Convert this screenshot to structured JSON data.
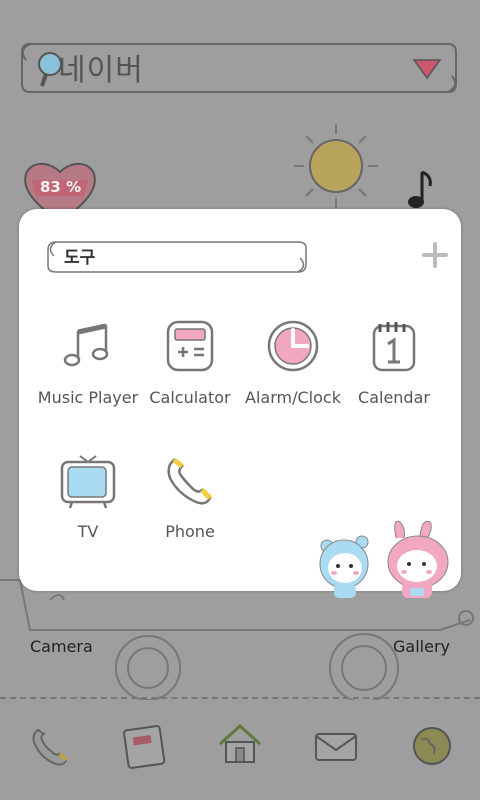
{
  "search": {
    "text": "네이버"
  },
  "battery": {
    "percent_text": "83 %"
  },
  "home": {
    "camera_label": "Camera",
    "gallery_label": "Gallery"
  },
  "folder": {
    "name": "도구",
    "apps": [
      {
        "label": "Music Player",
        "icon": "music-note-icon"
      },
      {
        "label": "Calculator",
        "icon": "calculator-icon"
      },
      {
        "label": "Alarm/Clock",
        "icon": "clock-icon"
      },
      {
        "label": "Calendar",
        "icon": "calendar-icon"
      },
      {
        "label": "TV",
        "icon": "tv-icon"
      },
      {
        "label": "Phone",
        "icon": "phone-icon"
      }
    ]
  },
  "dock": {
    "icons": [
      "phone-icon",
      "contacts-book-icon",
      "home-icon",
      "mail-icon",
      "browser-globe-icon"
    ]
  },
  "colors": {
    "accent_pink": "#f2a7c3",
    "accent_blue": "#a9dcf2",
    "sun_yellow": "#f1cf3f",
    "overlay": "#9e9e9e"
  }
}
